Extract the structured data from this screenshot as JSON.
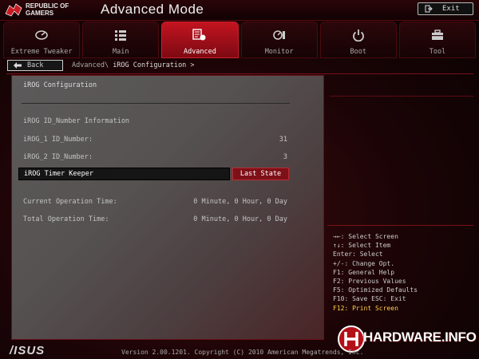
{
  "header": {
    "brand_line1": "REPUBLIC OF",
    "brand_line2": "GAMERS",
    "mode_title": "Advanced Mode",
    "exit_label": "Exit"
  },
  "tabs": [
    {
      "label": "Extreme Tweaker",
      "icon": "gauge-icon"
    },
    {
      "label": "Main",
      "icon": "list-icon"
    },
    {
      "label": "Advanced",
      "icon": "advanced-icon",
      "active": true
    },
    {
      "label": "Monitor",
      "icon": "monitor-icon"
    },
    {
      "label": "Boot",
      "icon": "power-icon"
    },
    {
      "label": "Tool",
      "icon": "toolbox-icon"
    }
  ],
  "nav": {
    "back_label": "Back",
    "breadcrumb_parent": "Advanced\\",
    "breadcrumb_current": "iROG Configuration >"
  },
  "panel": {
    "section_title": "iROG Configuration",
    "info_heading": "iROG ID_Number Information",
    "rows": [
      {
        "label": "iROG_1  ID_Number:",
        "value": "31"
      },
      {
        "label": "iROG_2  ID_Number:",
        "value": "3"
      }
    ],
    "timer_label": "iROG Timer Keeper",
    "timer_value": "Last State",
    "time_rows": [
      {
        "label": "Current Operation Time:",
        "value": "0 Minute, 0 Hour, 0 Day"
      },
      {
        "label": "Total Operation Time:",
        "value": "0 Minute, 0 Hour, 0 Day"
      }
    ]
  },
  "help": [
    "→←: Select Screen",
    "↑↓: Select Item",
    "Enter: Select",
    "+/-: Change Opt.",
    "F1: General Help",
    "F2: Previous Values",
    "F5: Optimized Defaults",
    "F10: Save  ESC: Exit",
    "F12: Print Screen"
  ],
  "help_highlight": "F12: Print Screen",
  "footer": {
    "version": "Version 2.00.1201. Copyright (C) 2010 American Megatrends, Inc.",
    "asus_logo": "/ISUS",
    "watermark": "HARDWARE.INFO"
  },
  "colors": {
    "accent": "#c21420",
    "highlight": "#ffd04a"
  }
}
